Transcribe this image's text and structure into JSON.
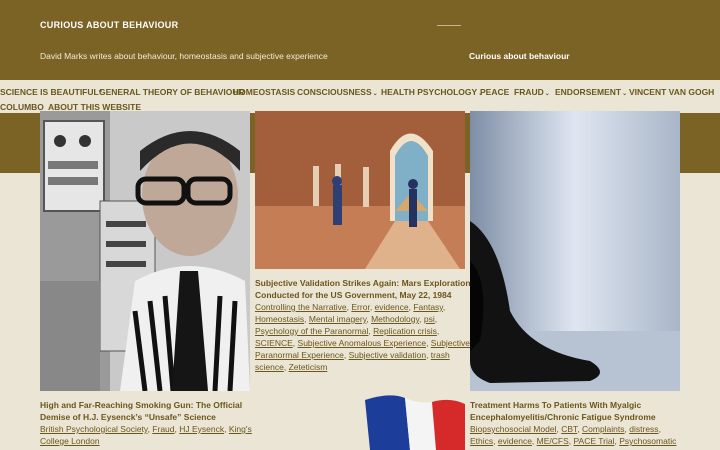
{
  "site": {
    "title": "CURIOUS ABOUT BEHAVIOUR",
    "tagline": "David Marks writes about behaviour, homeostasis and subjective experience",
    "widget_title": "Curious about behaviour"
  },
  "nav": {
    "items": [
      {
        "label": "SCIENCE IS BEAUTIFUL*",
        "dropdown": false
      },
      {
        "label": "GENERAL THEORY OF BEHAVIOUR",
        "dropdown": false
      },
      {
        "label": "HOMEOSTASIS",
        "dropdown": false
      },
      {
        "label": "CONSCIOUSNESS",
        "dropdown": true
      },
      {
        "label": "HEALTH PSYCHOLOGY",
        "dropdown": true
      },
      {
        "label": "PEACE",
        "dropdown": false
      },
      {
        "label": "FRAUD",
        "dropdown": true
      },
      {
        "label": "ENDORSEMENT",
        "dropdown": true
      },
      {
        "label": "VINCENT VAN GOGH",
        "dropdown": false
      },
      {
        "label": "COLUMBO",
        "dropdown": false
      },
      {
        "label": "ABOUT THIS WEBSITE",
        "dropdown": false
      }
    ],
    "chevron": "⌄"
  },
  "posts": [
    {
      "title_lines": [
        "High and Far-Reaching Smoking Gun: The Official",
        "Demise of H.J. Eysenck’s “Unsafe” Science"
      ],
      "tag_lines": [
        [
          "British Psychological Society",
          "Fraud",
          "HJ Eysenck",
          "King's"
        ],
        [
          "College London"
        ]
      ]
    },
    {
      "title_lines": [
        "Subjective Validation Strikes Again: Mars Exploration",
        "Conducted for the US Government, May 22, 1984"
      ],
      "tag_lines": [
        [
          "Controlling the Narrative",
          "Error",
          "evidence",
          "Fantasy"
        ],
        [
          "Homeostasis",
          "Mental imagery",
          "Methodology",
          "psi"
        ],
        [
          "Psychology of the Paranormal",
          "Replication crisis"
        ],
        [
          "SCIENCE",
          "Subjective Anomalous Experience",
          "Subjective"
        ],
        [
          "Paranormal Experience",
          "Subjective validation",
          "trash"
        ],
        [
          "science",
          "Zeteticism"
        ]
      ]
    },
    {
      "title_lines": [
        "Treatment Harms To Patients With Myalgic",
        "Encephalomyelitis/Chronic Fatigue Syndrome"
      ],
      "tag_lines": [
        [
          "Biopsychosocial Model",
          "CBT",
          "Complaints",
          "distress"
        ],
        [
          "Ethics",
          "evidence",
          "ME/CFS",
          "PACE Trial",
          "Psychosomatic"
        ]
      ]
    }
  ],
  "colors": {
    "header_brown": "#7b6225",
    "background": "#ebe5d6",
    "link": "#6a571b"
  }
}
